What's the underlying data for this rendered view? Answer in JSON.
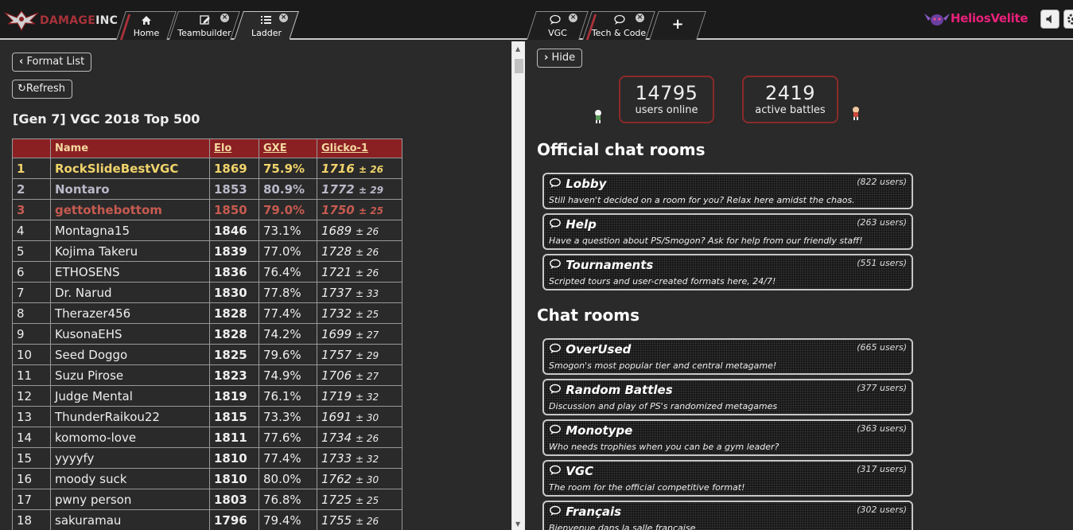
{
  "header": {
    "logo_left": "DAMAGE",
    "logo_right": "INC",
    "tabs": [
      {
        "label": "Home"
      },
      {
        "label": "Teambuilder"
      },
      {
        "label": "Ladder"
      },
      {
        "label": "VGC"
      },
      {
        "label": "Tech & Code"
      }
    ],
    "new_tab_symbol": "+",
    "close_symbol": "×",
    "username": "HeliosVelite"
  },
  "ladder": {
    "format_list_label": "Format List",
    "refresh_label": "Refresh",
    "title": "[Gen 7] VGC 2018 Top 500",
    "columns": [
      "Name",
      "Elo",
      "GXE",
      "Glicko-1"
    ],
    "rows": [
      {
        "rank": "1",
        "name": "RockSlideBestVGC",
        "elo": "1869",
        "gxe": "75.9%",
        "glicko": "1716",
        "dev": "± 26"
      },
      {
        "rank": "2",
        "name": "Nontaro",
        "elo": "1853",
        "gxe": "80.9%",
        "glicko": "1772",
        "dev": "± 29"
      },
      {
        "rank": "3",
        "name": "gettothebottom",
        "elo": "1850",
        "gxe": "79.0%",
        "glicko": "1750",
        "dev": "± 25"
      },
      {
        "rank": "4",
        "name": "Montagna15",
        "elo": "1846",
        "gxe": "73.1%",
        "glicko": "1689",
        "dev": "± 26"
      },
      {
        "rank": "5",
        "name": "Kojima Takeru",
        "elo": "1839",
        "gxe": "77.0%",
        "glicko": "1728",
        "dev": "± 26"
      },
      {
        "rank": "6",
        "name": "ETHOSENS",
        "elo": "1836",
        "gxe": "76.4%",
        "glicko": "1721",
        "dev": "± 26"
      },
      {
        "rank": "7",
        "name": "Dr. Narud",
        "elo": "1830",
        "gxe": "77.8%",
        "glicko": "1737",
        "dev": "± 33"
      },
      {
        "rank": "8",
        "name": "Therazer456",
        "elo": "1828",
        "gxe": "77.4%",
        "glicko": "1732",
        "dev": "± 25"
      },
      {
        "rank": "9",
        "name": "KusonaEHS",
        "elo": "1828",
        "gxe": "74.2%",
        "glicko": "1699",
        "dev": "± 27"
      },
      {
        "rank": "10",
        "name": "Seed Doggo",
        "elo": "1825",
        "gxe": "79.6%",
        "glicko": "1757",
        "dev": "± 29"
      },
      {
        "rank": "11",
        "name": "Suzu Pirose",
        "elo": "1823",
        "gxe": "74.9%",
        "glicko": "1706",
        "dev": "± 27"
      },
      {
        "rank": "12",
        "name": "Judge Mental",
        "elo": "1819",
        "gxe": "76.1%",
        "glicko": "1719",
        "dev": "± 32"
      },
      {
        "rank": "13",
        "name": "ThunderRaikou22",
        "elo": "1815",
        "gxe": "73.3%",
        "glicko": "1691",
        "dev": "± 30"
      },
      {
        "rank": "14",
        "name": "komomo-love",
        "elo": "1811",
        "gxe": "77.6%",
        "glicko": "1734",
        "dev": "± 26"
      },
      {
        "rank": "15",
        "name": "yyyyfy",
        "elo": "1810",
        "gxe": "77.4%",
        "glicko": "1733",
        "dev": "± 32"
      },
      {
        "rank": "16",
        "name": "moody suck",
        "elo": "1810",
        "gxe": "80.0%",
        "glicko": "1762",
        "dev": "± 30"
      },
      {
        "rank": "17",
        "name": "pwny person",
        "elo": "1803",
        "gxe": "76.8%",
        "glicko": "1725",
        "dev": "± 25"
      },
      {
        "rank": "18",
        "name": "sakuramau",
        "elo": "1796",
        "gxe": "79.4%",
        "glicko": "1755",
        "dev": "± 26"
      }
    ]
  },
  "main": {
    "hide_label": "Hide",
    "stats": {
      "users_online": "14795",
      "users_online_label": "users online",
      "active_battles": "2419",
      "active_battles_label": "active battles"
    },
    "official_title": "Official chat rooms",
    "official_rooms": [
      {
        "name": "Lobby",
        "users": "(822 users)",
        "desc": "Still haven't decided on a room for you? Relax here amidst the chaos."
      },
      {
        "name": "Help",
        "users": "(263 users)",
        "desc": "Have a question about PS/Smogon? Ask for help from our friendly staff!"
      },
      {
        "name": "Tournaments",
        "users": "(551 users)",
        "desc": "Scripted tours and user-created formats here, 24/7!"
      }
    ],
    "chat_title": "Chat rooms",
    "chat_rooms": [
      {
        "name": "OverUsed",
        "users": "(665 users)",
        "desc": "Smogon's most popular tier and central metagame!"
      },
      {
        "name": "Random Battles",
        "users": "(377 users)",
        "desc": "Discussion and play of PS's randomized metagames"
      },
      {
        "name": "Monotype",
        "users": "(363 users)",
        "desc": "Who needs trophies when you can be a gym leader?"
      },
      {
        "name": "VGC",
        "users": "(317 users)",
        "desc": "The room for the official competitive format!"
      },
      {
        "name": "Français",
        "users": "(302 users)",
        "desc": "Bienvenue dans la salle française"
      }
    ]
  },
  "colors": {
    "header_bg": "#1a1a1a",
    "pane_bg": "#2a2a2a",
    "table_header_bg": "#8b2023",
    "table_header_text": "#f4d9a0",
    "gold": "#f0d36a",
    "silver": "#b8b8c8",
    "bronze": "#c65a50",
    "username": "#e8207a",
    "stat_border": "#8b2a2a"
  },
  "icons": [
    "logo-eagle",
    "home-icon",
    "edit-icon",
    "list-icon",
    "chat-icon",
    "close-icon",
    "plus-icon",
    "avatar-icon",
    "volume-icon",
    "gear-icon",
    "chevron-left-icon",
    "refresh-icon"
  ]
}
